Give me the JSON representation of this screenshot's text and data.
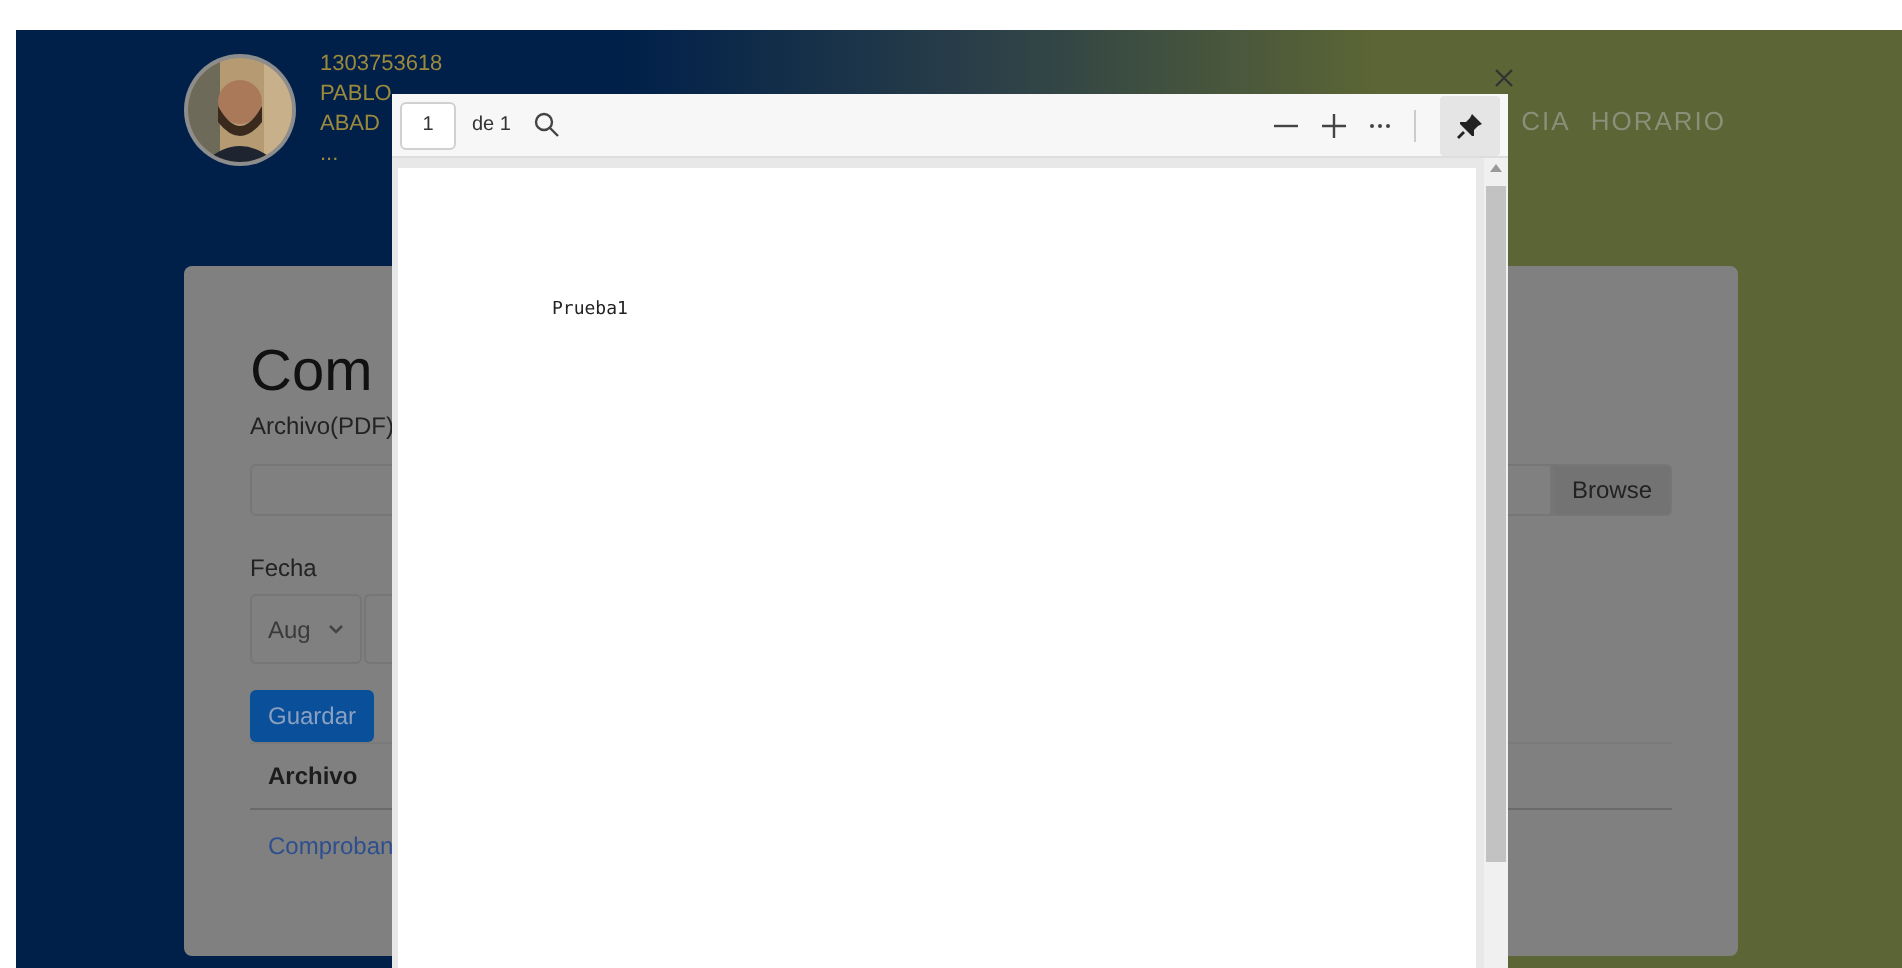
{
  "header": {
    "user_id": "1303753618",
    "name_lines": [
      "PABLO",
      "ABAD"
    ],
    "more": "...",
    "nav": [
      "CIA",
      "HORARIO"
    ]
  },
  "form": {
    "title": "Com",
    "file_label": "Archivo(PDF)",
    "browse_button": "Browse",
    "date_label": "Fecha",
    "month_select": "Aug",
    "save_button": "Guardar",
    "table": {
      "columns": [
        "Archivo"
      ],
      "rows": [
        [
          "Comproban"
        ]
      ]
    }
  },
  "pdf_viewer": {
    "page_input": "1",
    "page_count": "de 1",
    "document_text": "Prueba1"
  }
}
